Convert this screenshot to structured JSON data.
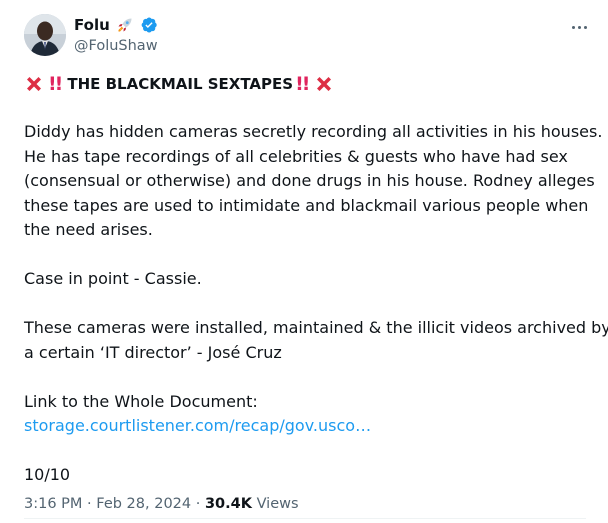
{
  "tweet": {
    "display_name": "Folu",
    "handle": "@FoluShaw",
    "headline": "THE BLACKMAIL SEXTAPES",
    "paragraphs": {
      "p1_line1": "Diddy has  hidden cameras secretly recording all activities in his houses.",
      "p1_line2": "He has tape recordings of all celebrities & guests who have had sex",
      "p1_line3": "(consensual or otherwise) and done drugs in his house. Rodney alleges",
      "p1_line4": "these tapes are used to intimidate and blackmail various people when",
      "p1_line5": "the need arises.",
      "p2": "Case in point - Cassie.",
      "p3_line1": "These cameras were installed, maintained & the illicit videos archived by",
      "p3_line2": "a certain ‘IT director’ - José Cruz",
      "p4_label": "Link to the Whole Document:",
      "p4_link": "storage.courtlistener.com/recap/gov.usco…",
      "p5": "10/10"
    },
    "meta": {
      "time": "3:16 PM",
      "separator1": "·",
      "date": "Feb 28, 2024",
      "separator2": "·",
      "views_count": "30.4K",
      "views_label": "Views"
    },
    "icons": {
      "verified": "verified-badge-icon",
      "rocket": "rocket-emoji-icon",
      "cross": "red-cross-emoji-icon",
      "bang": "double-exclamation-emoji-icon",
      "more": "more-options-icon"
    },
    "colors": {
      "text": "#0f1419",
      "secondary": "#536471",
      "link": "#1d9bf0",
      "emoji_red": "#e0245e"
    }
  }
}
